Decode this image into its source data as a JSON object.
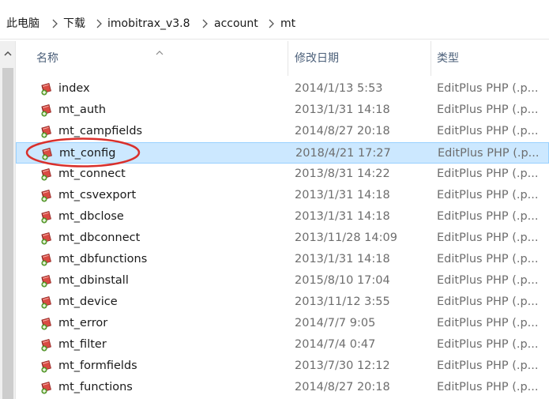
{
  "breadcrumb": {
    "items": [
      "此电脑",
      "下载",
      "imobitrax_v3.8",
      "account",
      "mt"
    ]
  },
  "columns": {
    "name": "名称",
    "date": "修改日期",
    "type": "类型"
  },
  "files": [
    {
      "name": "index",
      "date": "2014/1/13 5:53",
      "type": "EditPlus PHP (.p..."
    },
    {
      "name": "mt_auth",
      "date": "2013/1/31 14:18",
      "type": "EditPlus PHP (.p..."
    },
    {
      "name": "mt_campfields",
      "date": "2014/8/27 20:18",
      "type": "EditPlus PHP (.p..."
    },
    {
      "name": "mt_config",
      "date": "2018/4/21 17:27",
      "type": "EditPlus PHP (.p...",
      "selected": true
    },
    {
      "name": "mt_connect",
      "date": "2013/8/31 14:22",
      "type": "EditPlus PHP (.p..."
    },
    {
      "name": "mt_csvexport",
      "date": "2013/1/31 14:18",
      "type": "EditPlus PHP (.p..."
    },
    {
      "name": "mt_dbclose",
      "date": "2013/1/31 14:18",
      "type": "EditPlus PHP (.p..."
    },
    {
      "name": "mt_dbconnect",
      "date": "2013/11/28 14:09",
      "type": "EditPlus PHP (.p..."
    },
    {
      "name": "mt_dbfunctions",
      "date": "2013/1/31 14:18",
      "type": "EditPlus PHP (.p..."
    },
    {
      "name": "mt_dbinstall",
      "date": "2015/8/10 17:04",
      "type": "EditPlus PHP (.p..."
    },
    {
      "name": "mt_device",
      "date": "2013/11/12 3:55",
      "type": "EditPlus PHP (.p..."
    },
    {
      "name": "mt_error",
      "date": "2014/7/7 9:05",
      "type": "EditPlus PHP (.p..."
    },
    {
      "name": "mt_filter",
      "date": "2014/7/4 0:47",
      "type": "EditPlus PHP (.p..."
    },
    {
      "name": "mt_formfields",
      "date": "2013/7/30 12:12",
      "type": "EditPlus PHP (.p..."
    },
    {
      "name": "mt_functions",
      "date": "2014/8/27 20:18",
      "type": "EditPlus PHP (.p..."
    }
  ],
  "colors": {
    "selection_bg": "#cce8ff",
    "selection_border": "#99d1ff",
    "header_text": "#4c607a",
    "annotation_red": "#d9302c"
  },
  "icons": {
    "file": "editplus-php-file-icon",
    "separator": "chevron-right-icon",
    "sort": "sort-ascending-icon",
    "scroll_up": "scroll-up-arrow-icon"
  }
}
